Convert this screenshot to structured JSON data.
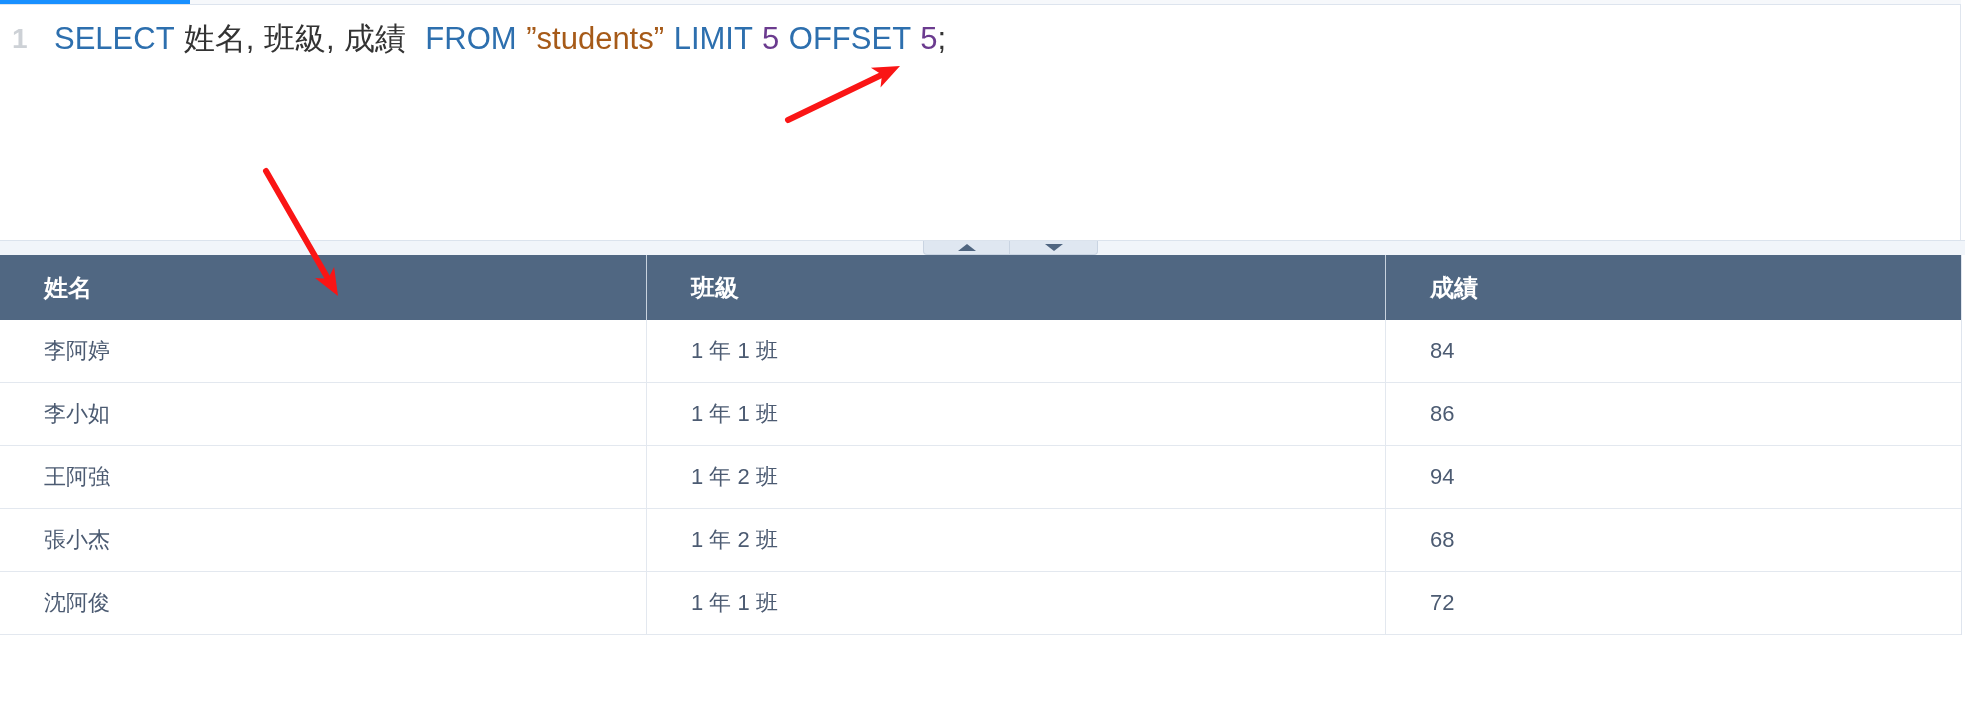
{
  "progress": {
    "level": 0.097
  },
  "editor": {
    "lines": [
      {
        "number": "1",
        "tokens": [
          {
            "kind": "keyword",
            "text": "SELECT"
          },
          {
            "kind": "plain",
            "text": " 姓名, 班級, 成績  "
          },
          {
            "kind": "keyword",
            "text": "FROM "
          },
          {
            "kind": "string",
            "text": "”students” "
          },
          {
            "kind": "keyword",
            "text": "LIMIT "
          },
          {
            "kind": "number",
            "text": "5 "
          },
          {
            "kind": "keyword",
            "text": "OFFSET "
          },
          {
            "kind": "number",
            "text": "5"
          },
          {
            "kind": "plain",
            "text": ";"
          }
        ]
      }
    ]
  },
  "table": {
    "columns": [
      {
        "label": "姓名"
      },
      {
        "label": "班級"
      },
      {
        "label": "成績"
      }
    ],
    "rows": [
      [
        "李阿婷",
        "1 年 1 班",
        "84"
      ],
      [
        "李小如",
        "1 年 1 班",
        "86"
      ],
      [
        "王阿強",
        "1 年 2 班",
        "94"
      ],
      [
        "張小杰",
        "1 年 2 班",
        "68"
      ],
      [
        "沈阿俊",
        "1 年 1 班",
        "72"
      ]
    ]
  },
  "annotations": [
    {
      "kind": "arrow"
    },
    {
      "kind": "arrow"
    }
  ]
}
